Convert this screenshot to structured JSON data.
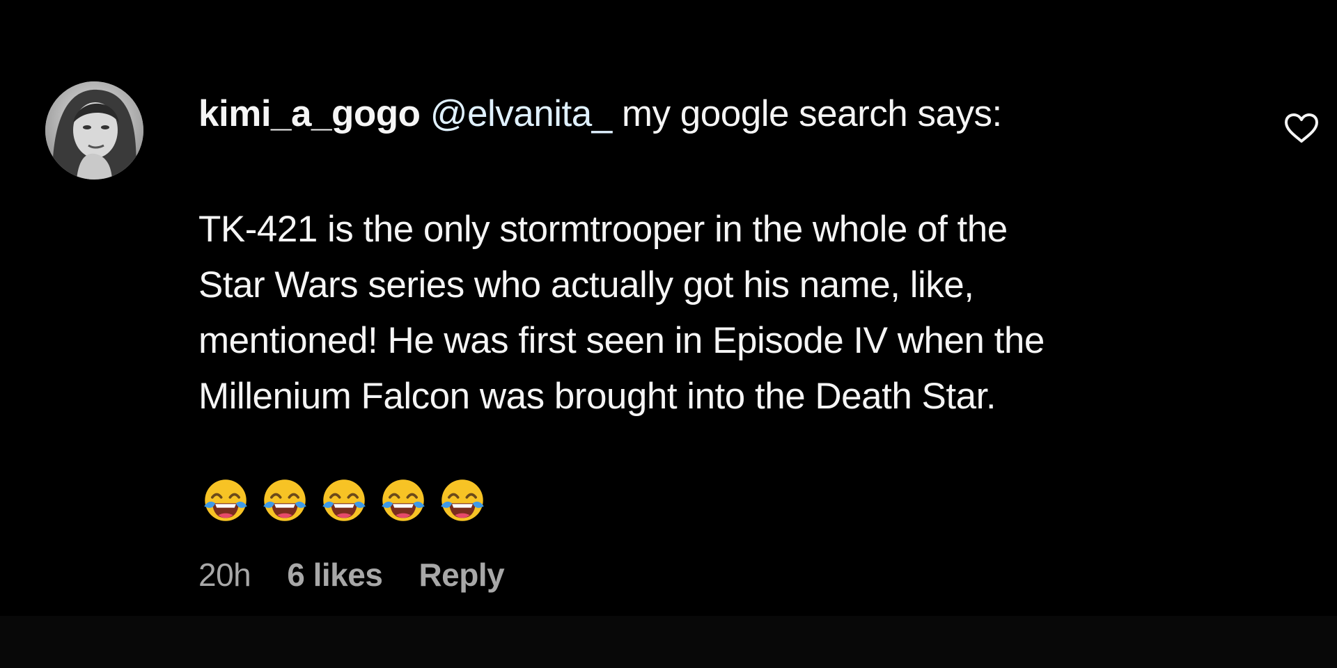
{
  "comment": {
    "username": "kimi_a_gogo",
    "mention": "@elvanita_",
    "header_text": "my google search says:",
    "body_lines": [
      "TK-421 is the only stormtrooper in the whole of the",
      "Star Wars series who actually got his name, like,",
      "mentioned! He was first seen in Episode IV when the",
      "Millenium Falcon was brought into the Death Star."
    ],
    "emojis": [
      "😂",
      "😂",
      "😂",
      "😂",
      "😂"
    ],
    "time": "20h",
    "likes": "6 likes",
    "reply_label": "Reply",
    "icons": {
      "like": "heart-outline-icon",
      "avatar": "user-avatar"
    }
  },
  "colors": {
    "background": "#000000",
    "text": "#f5f5f5",
    "mention": "#e0f1ff",
    "meta": "#a8a8a8"
  }
}
